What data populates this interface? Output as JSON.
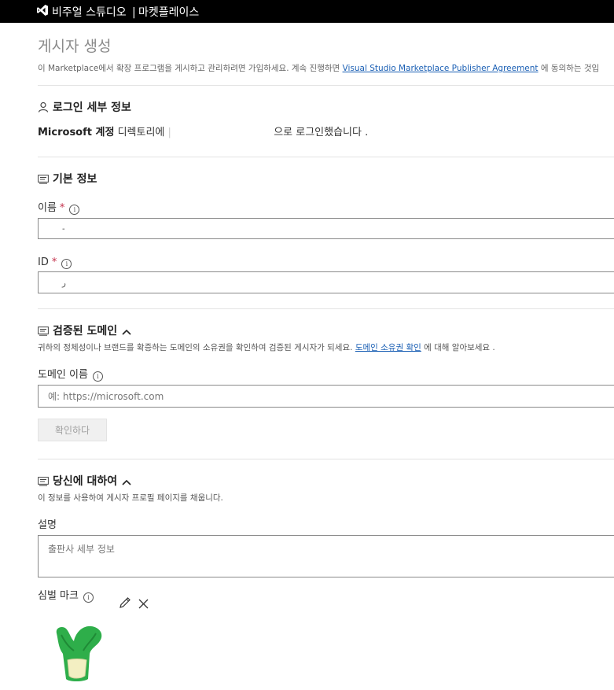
{
  "header": {
    "brand": "비주얼 스튜디오",
    "separator": "|",
    "section": "마켓플레이스",
    "logo_icon": "visual-studio-logo-icon"
  },
  "page": {
    "title": "게시자 생성",
    "intro_text": "이 Marketplace에서 확장 프로그램을 게시하고 관리하려면 가입하세요. 계속 진행하면",
    "intro_link": "Visual Studio Marketplace Publisher Agreement",
    "intro_suffix": "에 동의하는 것입"
  },
  "login_section": {
    "title": "로그인 세부 정보",
    "icon": "person-icon",
    "account_label": "Microsoft 계정",
    "directory_text": "디렉토리에",
    "bar": "|",
    "logged_in_text": "으로 로그인했습니다 ."
  },
  "basic_section": {
    "title": "기본 정보",
    "icon": "card-icon",
    "name_label": "이름",
    "name_required": "*",
    "name_value": "-",
    "id_label": "ID",
    "id_required": "*",
    "id_value": "ر"
  },
  "domain_section": {
    "title": "검증된 도메인",
    "icon": "card-icon",
    "description": "귀하의 정체성이나 브랜드를 확증하는 도메인의 소유권을 확인하여 검증된 게시자가 되세요.",
    "description_link": "도메인 소유권 확인",
    "description_suffix": "에 대해 알아보세요 .",
    "domain_label": "도메인 이름",
    "domain_placeholder": "예: https://microsoft.com",
    "verify_button": "확인하다"
  },
  "about_section": {
    "title": "당신에 대하여",
    "icon": "card-icon",
    "description": "이 정보를 사용하여 게시자 프로필 페이지를 채웁니다.",
    "desc_label": "설명",
    "desc_placeholder": "출판사 세부 정보",
    "logo_label": "심벌 마크"
  },
  "colors": {
    "topbar": "#000000",
    "link": "#1a5fb4",
    "required": "#c4314b",
    "logo_green": "#2eae4a",
    "logo_cream": "#f3efc2"
  }
}
